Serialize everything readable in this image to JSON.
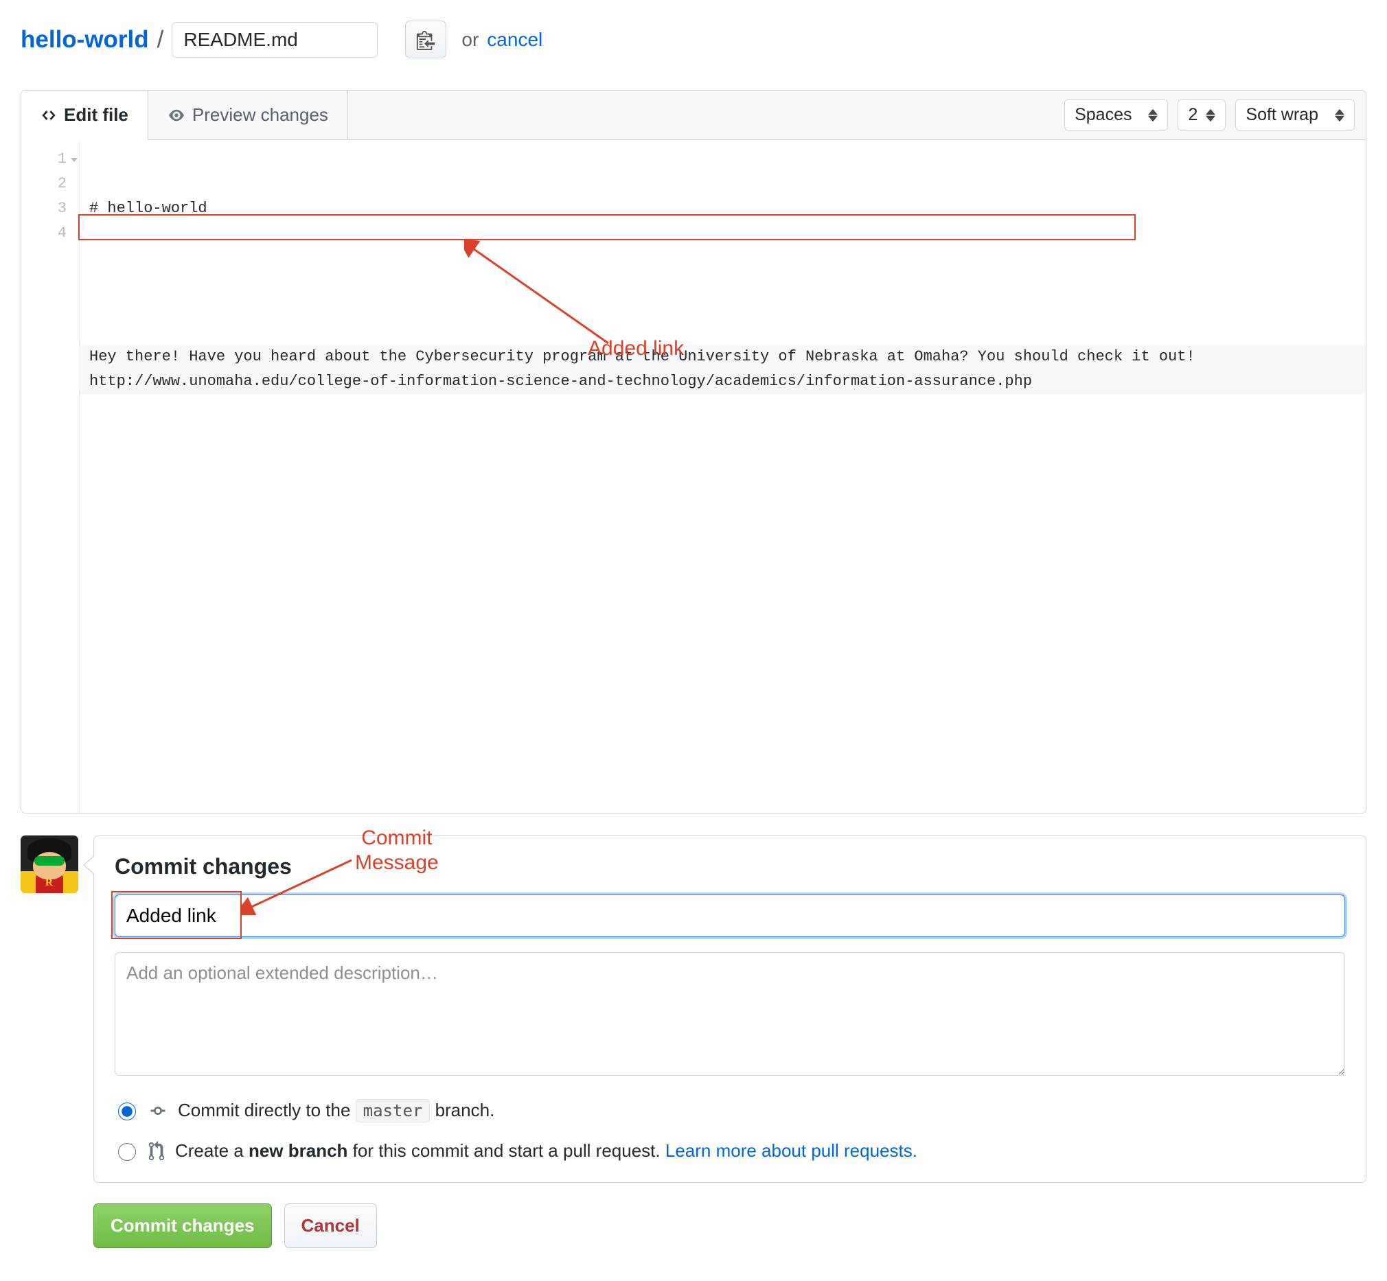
{
  "breadcrumb": {
    "repo": "hello-world",
    "separator": "/",
    "filename_value": "README.md",
    "or_text": "or",
    "cancel": "cancel"
  },
  "tabs": {
    "edit": "Edit file",
    "preview": "Preview changes"
  },
  "toolbar": {
    "indent_mode": "Spaces",
    "indent_size": "2",
    "wrap_mode": "Soft wrap"
  },
  "editor": {
    "line_numbers": [
      "1",
      "2",
      "3",
      "4"
    ],
    "lines": {
      "l1": "# hello-world",
      "l2": "",
      "l3": "Hey there! Have you heard about the Cybersecurity program at the University of Nebraska at Omaha? You should check it out! http://www.unomaha.edu/college-of-information-science-and-technology/academics/information-assurance.php",
      "l4": ""
    }
  },
  "annotations": {
    "added_link": "Added link",
    "commit_message": "Commit\nMessage"
  },
  "commit": {
    "heading": "Commit changes",
    "summary_value": "Added link",
    "description_placeholder": "Add an optional extended description…",
    "option_direct_pre": "Commit directly to the ",
    "option_direct_branch": "master",
    "option_direct_post": " branch.",
    "option_branch_pre": "Create a ",
    "option_branch_bold": "new branch",
    "option_branch_post": " for this commit and start a pull request. ",
    "learn_more": "Learn more about pull requests.",
    "commit_btn": "Commit changes",
    "cancel_btn": "Cancel"
  }
}
